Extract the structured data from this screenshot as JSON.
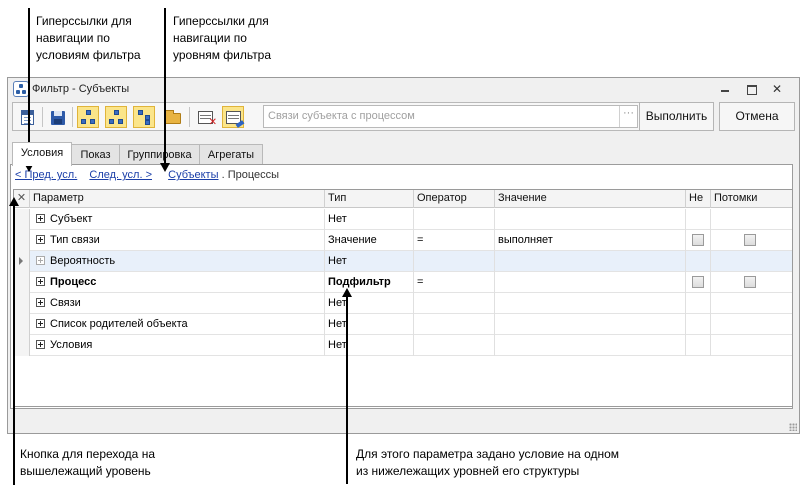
{
  "annotations": {
    "hyperlinks_conditions": [
      "Гиперссылки для",
      "навигации по",
      "условиям фильтра"
    ],
    "hyperlinks_levels": [
      "Гиперссылки для",
      "навигации по",
      "уровням фильтра"
    ],
    "up_button": [
      "Кнопка для перехода на",
      "вышележащий уровень"
    ],
    "subfilter_note": [
      "Для этого параметра задано условие на одном",
      "из нижележащих уровней его структуры"
    ]
  },
  "window": {
    "title": "Фильтр - Субъекты",
    "close_glyph": "✕"
  },
  "toolbar": {
    "filter_placeholder": "Связи субъекта с процессом",
    "dropdown_glyph": "···",
    "run_label": "Выполнить",
    "cancel_label": "Отмена"
  },
  "tabs": [
    {
      "label": "Условия",
      "active": true
    },
    {
      "label": "Показ",
      "active": false
    },
    {
      "label": "Группировка",
      "active": false
    },
    {
      "label": "Агрегаты",
      "active": false
    }
  ],
  "nav": {
    "prev_condition": "< Пред. усл.",
    "next_condition": "След. усл. >",
    "crumb_root": "Субъекты",
    "crumb_sep": ".",
    "crumb_current": "Процессы"
  },
  "grid": {
    "up_glyph": "✕",
    "columns": [
      "Параметр",
      "Тип",
      "Оператор",
      "Значение",
      "Не",
      "Потомки"
    ],
    "rows": [
      {
        "param": "Субъект",
        "type": "Нет",
        "operator": "",
        "value": ""
      },
      {
        "param": "Тип связи",
        "type": "Значение",
        "operator": "=",
        "value": "выполняет"
      },
      {
        "param": "Вероятность",
        "type": "Нет",
        "operator": "",
        "value": ""
      },
      {
        "param": "Процесс",
        "type": "Подфильтр",
        "operator": "=",
        "value": ""
      },
      {
        "param": "Связи",
        "type": "Нет",
        "operator": "",
        "value": ""
      },
      {
        "param": "Список родителей объекта",
        "type": "Нет",
        "operator": "",
        "value": ""
      },
      {
        "param": "Условия",
        "type": "Нет",
        "operator": "",
        "value": ""
      }
    ]
  }
}
